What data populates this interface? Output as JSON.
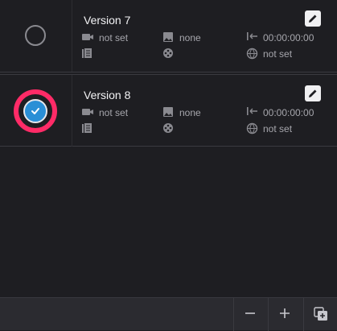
{
  "versions": [
    {
      "name": "Version 7",
      "selected": false,
      "video": "not set",
      "image": "none",
      "timecode": "00:00:00:00",
      "language": "not set"
    },
    {
      "name": "Version 8",
      "selected": true,
      "video": "not set",
      "image": "none",
      "timecode": "00:00:00:00",
      "language": "not set"
    }
  ],
  "toolbar": {
    "remove_icon": "minus-icon",
    "add_icon": "plus-icon",
    "duplicate_icon": "duplicate-plus-icon"
  },
  "colors": {
    "highlight_ring": "#ff2b67",
    "selected_radio": "#2a8fd6"
  }
}
